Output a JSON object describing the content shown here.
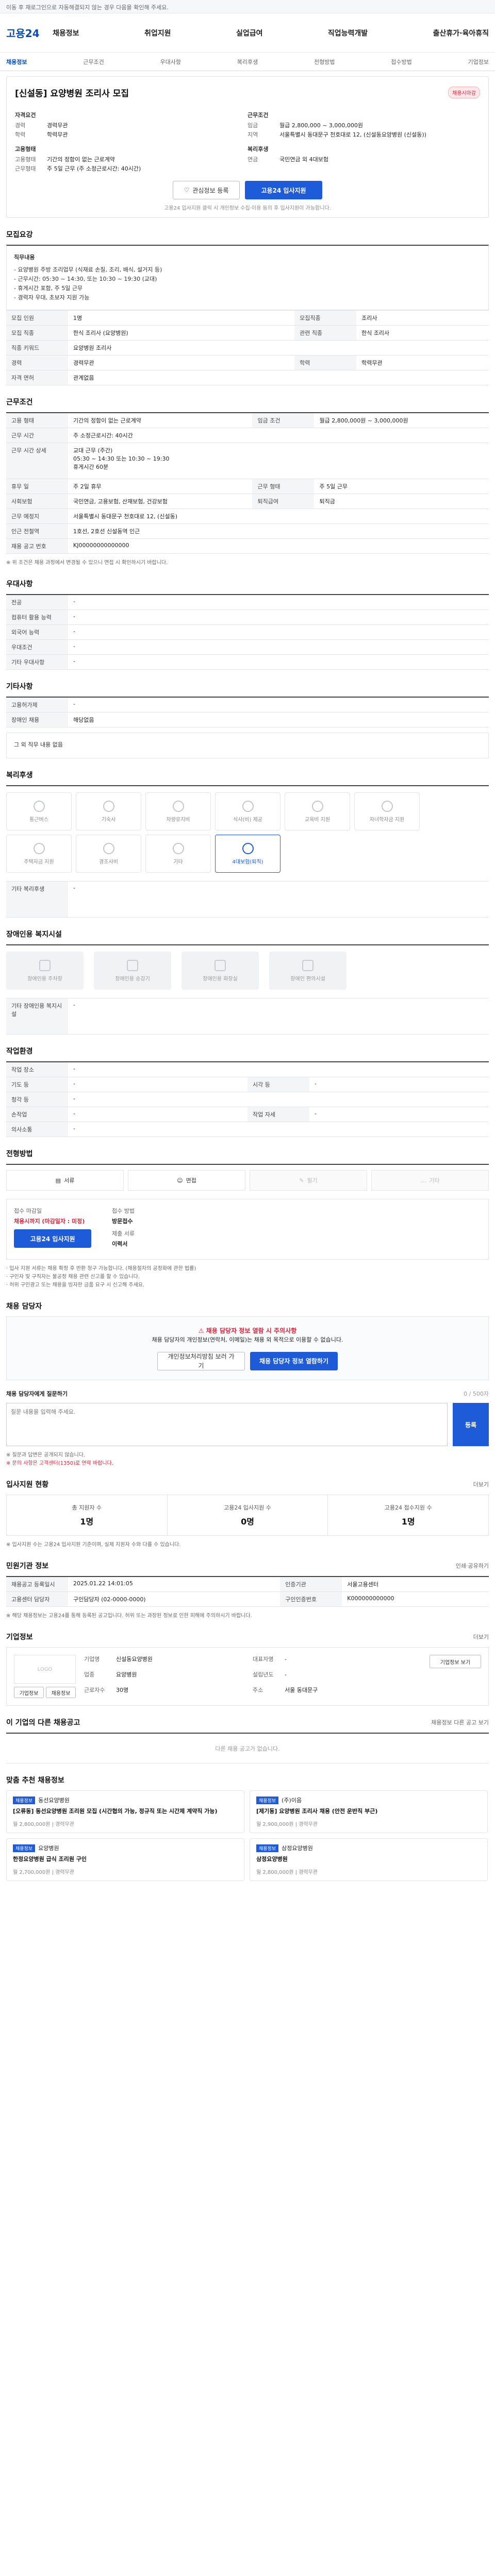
{
  "topbar": {
    "text": "이동 후 재로그인으로 자동해결되지 않는 경우 다음을 확인해 주세요."
  },
  "header": {
    "logo": "고용24",
    "menu": [
      "채용정보",
      "취업지원",
      "실업급여",
      "직업능력개발",
      "출산휴가·육아휴직"
    ]
  },
  "subnav": {
    "items": [
      "채용정보",
      "근무조건",
      "우대사항",
      "복리후생",
      "전형방법",
      "접수방법",
      "기업정보"
    ],
    "active_index": 0
  },
  "job": {
    "title": "[신설동] 요양병원 조리사 모집",
    "badge": "채용시마감",
    "left_h": "자격요건",
    "left": [
      {
        "k": "경력",
        "v": "경력무관"
      },
      {
        "k": "학력",
        "v": "학력무관"
      }
    ],
    "right_h": "근무조건",
    "right": [
      {
        "k": "임금",
        "v": "월급 2,800,000 ~ 3,000,000원"
      },
      {
        "k": "지역",
        "v": "서울특별시 동대문구 천호대로 12, (신설동요양병원 (신설동))"
      }
    ],
    "left2_h": "고용형태",
    "left2": [
      {
        "k": "고용형태",
        "v": "기간의 정함이 없는 근로계약"
      },
      {
        "k": "근무형태",
        "v": "주 5일 근무 (주 소정근로시간: 40시간)"
      }
    ],
    "right2_h": "복리후생",
    "right2": [
      {
        "k": "연금",
        "v": "국민연금 외 4대보험"
      }
    ],
    "btn_scrap": "관심정보 등록",
    "btn_apply": "고용24 입사지원",
    "notice": "고용24 입사지원 클릭 시 개인정보 수집·이용 동의 후 입사지원이 가능합니다."
  },
  "detail": {
    "section_title": "모집요강",
    "duty_head": "직무내용",
    "duty_text": "- 요양병원 주방 조리업무 (식재료 손질, 조리, 배식, 설거지 등)\n- 근무시간: 05:30 ~ 14:30, 또는 10:30 ~ 19:30 (교대)\n- 휴게시간 포함, 주 5일 근무\n- 경력자 우대, 초보자 지원 가능",
    "rows": [
      {
        "k": "모집 인원",
        "v": "1명",
        "k2": "모집직종",
        "v2": "조리사"
      },
      {
        "k": "모집 직종",
        "v": "한식 조리사 (요양병원)",
        "k2": "관련 직종",
        "v2": "한식 조리사"
      },
      {
        "k": "직종 키워드",
        "v": "요양병원 조리사",
        "k2": "",
        "v2": ""
      },
      {
        "k": "경력",
        "v": "경력무관",
        "k2": "학력",
        "v2": "학력무관"
      },
      {
        "k": "자격 면허",
        "v": "관계없음",
        "k2": "",
        "v2": ""
      }
    ]
  },
  "condition": {
    "section_title": "근무조건",
    "rows": [
      {
        "k": "고용 형태",
        "v": "기간의 정함이 없는 근로계약",
        "k2": "임금 조건",
        "v2": "월급 2,800,000원 ~ 3,000,000원"
      },
      {
        "k": "근무 시간",
        "v": "주 소정근로시간: 40시간",
        "k2": "",
        "v2": ""
      },
      {
        "k": "근무 시간 상세",
        "v": "교대 근무 (주간)\n05:30 ~ 14:30 또는 10:30 ~ 19:30\n휴게시간 60분",
        "k2": "",
        "v2": ""
      },
      {
        "k": "휴무 일",
        "v": "주 2일 휴무",
        "k2": "근무 형태",
        "v2": "주 5일 근무"
      },
      {
        "k": "사회보험",
        "v": "국민연금, 고용보험, 산재보험, 건강보험",
        "k2": "퇴직급여",
        "v2": "퇴직금"
      },
      {
        "k": "근무 예정지",
        "v": "서울특별시 동대문구 천호대로 12, (신설동)",
        "k2": "",
        "v2": ""
      },
      {
        "k": "인근 전철역",
        "v": "1호선, 2호선 신설동역 인근",
        "k2": "",
        "v2": ""
      },
      {
        "k": "채용 공고 번호",
        "v": "KJ00000000000000",
        "k2": "",
        "v2": ""
      }
    ],
    "footnote": "※ 위 조건은 채용 과정에서 변경될 수 있으니 면접 시 확인하시기 바랍니다."
  },
  "preference": {
    "section_title": "우대사항",
    "rows": [
      {
        "k": "전공",
        "v": "-"
      },
      {
        "k": "컴퓨터 활용 능력",
        "v": "-"
      },
      {
        "k": "외국어 능력",
        "v": "-"
      },
      {
        "k": "우대조건",
        "v": "-"
      },
      {
        "k": "기타 우대사항",
        "v": "-"
      }
    ]
  },
  "other_cond": {
    "section_title": "기타사항",
    "rows": [
      {
        "k": "고용허가제",
        "v": "-"
      },
      {
        "k": "장애인 채용",
        "v": "해당없음"
      }
    ],
    "extra": "그 외 직무 내용 없음"
  },
  "welfare": {
    "section_title": "복리후생",
    "items": [
      {
        "label": "통근버스",
        "on": false
      },
      {
        "label": "기숙사",
        "on": false
      },
      {
        "label": "차량유지비",
        "on": false
      },
      {
        "label": "식사(비) 제공",
        "on": false
      },
      {
        "label": "교육비 지원",
        "on": false
      },
      {
        "label": "자녀학자금 지원",
        "on": false
      },
      {
        "label": "주택자금 지원",
        "on": false
      },
      {
        "label": "경조사비",
        "on": false
      },
      {
        "label": "기타",
        "on": false
      },
      {
        "label": "4대보험(퇴직)",
        "on": true
      }
    ],
    "other_label": "기타 복리후생",
    "other_value": "-"
  },
  "disability": {
    "section_title": "장애인용 복지시설",
    "items": [
      {
        "label": "장애인용 주차장"
      },
      {
        "label": "장애인용 승강기"
      },
      {
        "label": "장애인용 화장실"
      },
      {
        "label": "장애인 편의시설"
      }
    ],
    "other_label": "기타 장애인용 복지시설",
    "other_value": "-"
  },
  "work_env": {
    "section_title": "작업환경",
    "rows": [
      {
        "k": "작업 장소",
        "v": "-",
        "k2": "",
        "v2": ""
      },
      {
        "k": "기도 등",
        "v": "-",
        "k2": "시각 등",
        "v2": "-"
      },
      {
        "k": "청각 등",
        "v": "-",
        "k2": "",
        "v2": ""
      },
      {
        "k": "손작업",
        "v": "-",
        "k2": "작업 자세",
        "v2": "-"
      },
      {
        "k": "의사소통",
        "v": "-",
        "k2": "",
        "v2": ""
      }
    ]
  },
  "selection": {
    "section_title": "전형방법",
    "methods": [
      {
        "label": "서류",
        "on": true
      },
      {
        "label": "면접",
        "on": true
      },
      {
        "label": "필기",
        "on": false
      },
      {
        "label": "기타",
        "on": false
      }
    ]
  },
  "apply": {
    "label_deadline": "접수 마감일",
    "deadline": "채용시까지 (마감일자 : 미정)",
    "label_method": "접수 방법",
    "method": "방문접수",
    "btn_apply": "고용24 입사지원",
    "label_docs": "제출 서류",
    "docs": "이력서",
    "bullets": [
      "· 입사 지원 서류는 채용 확정 후 반환 청구 가능합니다. (채용절차의 공정화에 관한 법률)",
      "· 구인자 및 구직자는 불공정 채용 관련 신고를 할 수 있습니다.",
      "· 허위 구인광고 또는 채용을 빙자한 금품 요구 시 신고해 주세요."
    ]
  },
  "contact": {
    "section_title": "채용 담당자",
    "warn": "채용 담당자 정보 열람 시 주의사항",
    "text": "채용 담당자의 개인정보(연락처, 이메일)는 채용 외 목적으로 이용할 수 없습니다.",
    "btn_left": "개인정보처리방침 보러 가기",
    "btn_right": "채용 담당자 정보 열람하기",
    "qna_label": "채용 담당자에게 질문하기",
    "qna_hint": "0 / 500자",
    "qna_placeholder": "질문 내용을 입력해 주세요.",
    "qna_send": "등록",
    "qna_notes": [
      "※ 질문과 답변은 공개되지 않습니다.",
      "※ 문의 사항은 고객센터(1350)로 연락 바랍니다."
    ]
  },
  "status": {
    "section_title": "입사지원 현황",
    "more": "더보기",
    "items": [
      {
        "label": "총 지원자 수",
        "value": "1명"
      },
      {
        "label": "고용24 입사지원 수",
        "value": "0명"
      },
      {
        "label": "고용24 접수지원 수",
        "value": "1명"
      }
    ],
    "note": "※ 입사지원 수는 고용24 입사지원 기준이며, 실제 지원자 수와 다를 수 있습니다."
  },
  "agency": {
    "section_title": "민원기관 정보",
    "more": "인쇄·공유하기",
    "rows": [
      {
        "k": "채용공고 등록일시",
        "v": "2025.01.22 14:01:05",
        "k2": "인증기관",
        "v2": "서울고용센터"
      },
      {
        "k": "고용센터 담당자",
        "v": "구인담당자 (02-0000-0000)",
        "k2": "구인인증번호",
        "v2": "K000000000000"
      }
    ],
    "note": "※ 해당 채용정보는 고용24를 통해 등록된 공고입니다. 허위 또는 과장된 정보로 인한 피해에 주의하시기 바랍니다."
  },
  "company": {
    "section_title": "기업정보",
    "more": "더보기",
    "logo_text": "LOGO",
    "btn_a": "기업정보",
    "btn_b": "채용정보",
    "fields": [
      {
        "k": "기업명",
        "v": "신설동요양병원"
      },
      {
        "k": "업종",
        "v": "요양병원"
      },
      {
        "k": "근로자수",
        "v": "30명"
      },
      {
        "k": "대표자명",
        "v": "-"
      },
      {
        "k": "설립년도",
        "v": "-"
      },
      {
        "k": "주소",
        "v": "서울 동대문구"
      }
    ],
    "btn_more": "기업정보 보기"
  },
  "others": {
    "section_title": "이 기업의 다른 채용공고",
    "more": "채용정보 다른 공고 보기",
    "empty": "다른 채용 공고가 없습니다."
  },
  "recommend": {
    "section_title": "맞춤 추천 채용정보",
    "cards": [
      {
        "tag": "채용정보",
        "org": "동선요양병원",
        "title": "[오류동] 동선요양병원 조리원 모집 (시간협의 가능, 정규직 또는 시간제 계약직 가능)",
        "meta": "월 2,800,000원  |  경력무관"
      },
      {
        "tag": "채용정보",
        "org": "(주)이음",
        "title": "[제기동] 요양병원 조리사 채용 (안전 운반직 부근)",
        "meta": "월 2,900,000원  |  경력무관"
      },
      {
        "tag": "채용정보",
        "org": "요양병원",
        "title": "한정요양병원 급식 조리원 구인",
        "meta": "월 2,700,000원  |  경력무관"
      },
      {
        "tag": "채용정보",
        "org": "삼정요양병원",
        "title": "삼정요양병원",
        "meta": "월 2,800,000원  |  경력무관"
      }
    ]
  }
}
